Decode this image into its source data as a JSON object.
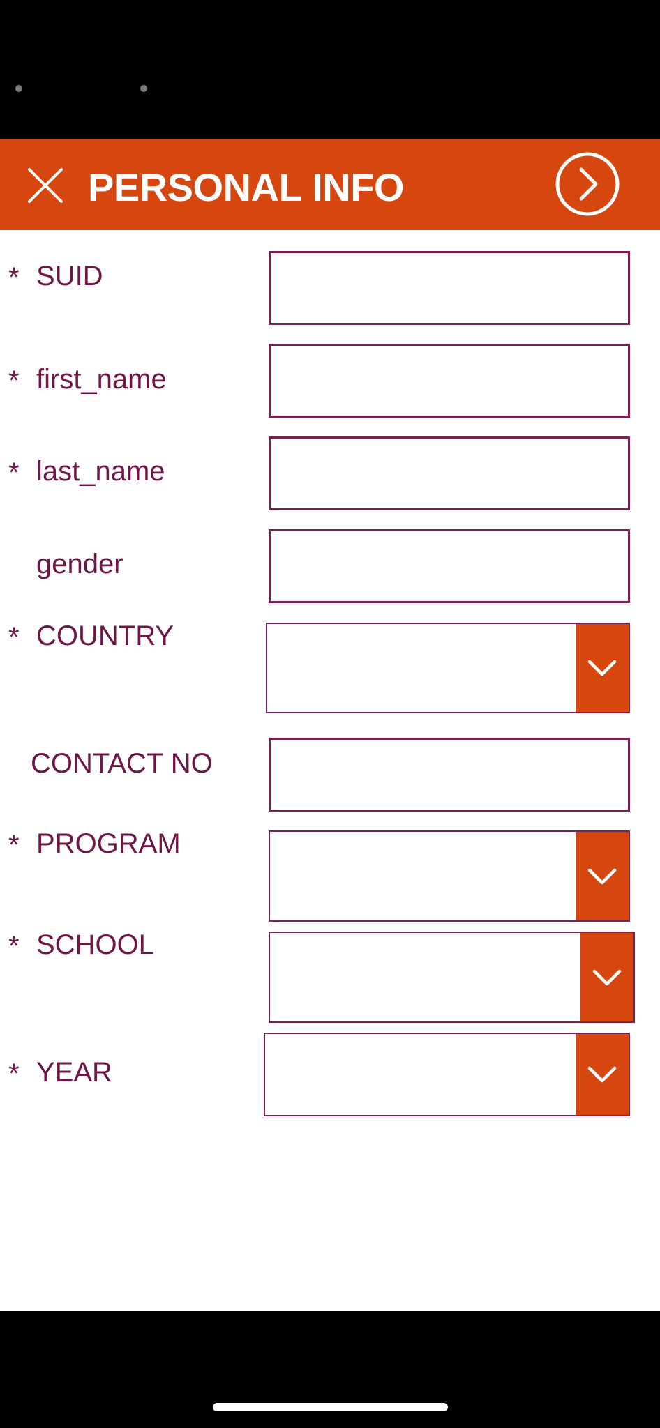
{
  "header": {
    "title": "PERSONAL INFO",
    "close_icon": "close-icon",
    "next_icon": "chevron-right-circle-icon"
  },
  "colors": {
    "header_bg": "#D5470F",
    "label_text": "#6E1747",
    "field_border": "#7B1F55",
    "dropdown_button": "#D5470F"
  },
  "form": {
    "required_marker": "*",
    "fields": [
      {
        "key": "suid",
        "label": "SUID",
        "required": true,
        "type": "text",
        "value": ""
      },
      {
        "key": "first_name",
        "label": "first_name",
        "required": true,
        "type": "text",
        "value": ""
      },
      {
        "key": "last_name",
        "label": "last_name",
        "required": true,
        "type": "text",
        "value": ""
      },
      {
        "key": "gender",
        "label": "gender",
        "required": false,
        "type": "text",
        "value": ""
      },
      {
        "key": "country",
        "label": "COUNTRY",
        "required": true,
        "type": "dropdown",
        "value": ""
      },
      {
        "key": "contact_no",
        "label": "CONTACT NO",
        "required": false,
        "type": "text",
        "value": ""
      },
      {
        "key": "program",
        "label": "PROGRAM",
        "required": true,
        "type": "dropdown",
        "value": ""
      },
      {
        "key": "school",
        "label": "SCHOOL",
        "required": true,
        "type": "dropdown",
        "value": ""
      },
      {
        "key": "year",
        "label": "YEAR",
        "required": true,
        "type": "dropdown",
        "value": ""
      }
    ]
  }
}
